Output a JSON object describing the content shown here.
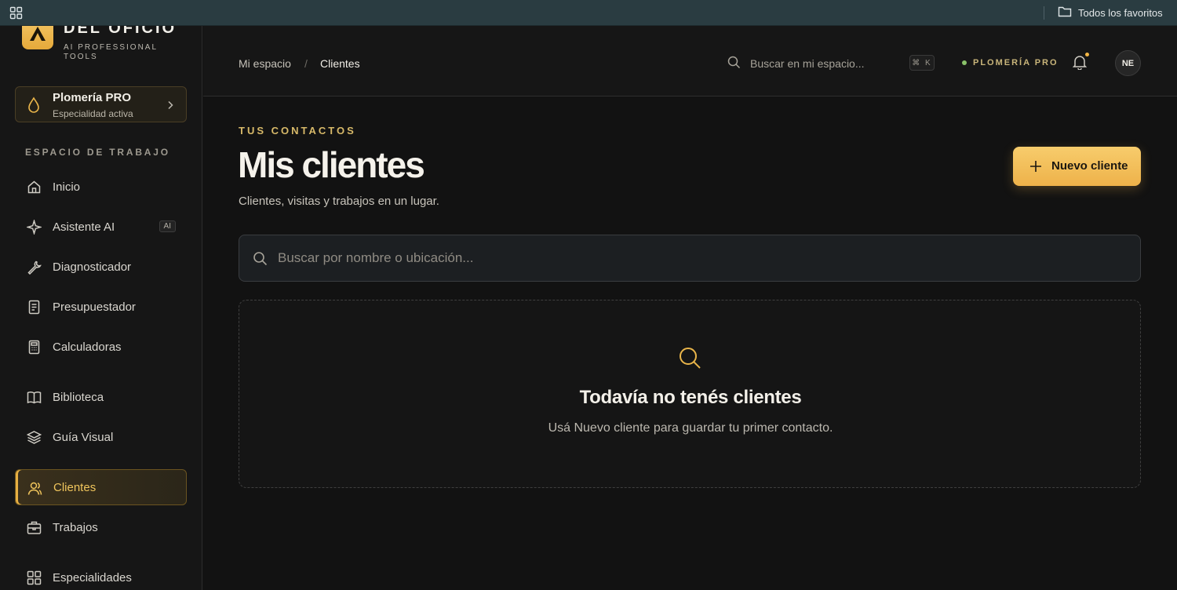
{
  "browser": {
    "favorites_label": "Todos los favoritos"
  },
  "brand": {
    "title": "DEL OFICIO",
    "subtitle": "AI PROFESSIONAL TOOLS",
    "accent": "#eeb24a"
  },
  "specialty": {
    "name": "Plomería PRO",
    "status": "Especialidad activa"
  },
  "sidebar": {
    "section_label": "ESPACIO DE TRABAJO",
    "items": [
      {
        "label": "Inicio",
        "icon": "home-icon"
      },
      {
        "label": "Asistente AI",
        "icon": "sparkle-icon",
        "badge": "AI"
      },
      {
        "label": "Diagnosticador",
        "icon": "wrench-icon"
      },
      {
        "label": "Presupuestador",
        "icon": "document-icon"
      },
      {
        "label": "Calculadoras",
        "icon": "calculator-icon"
      },
      {
        "label": "Biblioteca",
        "icon": "book-icon"
      },
      {
        "label": "Guía Visual",
        "icon": "layers-icon"
      },
      {
        "label": "Clientes",
        "icon": "users-icon",
        "active": true
      },
      {
        "label": "Trabajos",
        "icon": "briefcase-icon"
      },
      {
        "label": "Especialidades",
        "icon": "grid-icon"
      }
    ]
  },
  "header": {
    "breadcrumb": [
      "Mi espacio",
      "Clientes"
    ],
    "breadcrumb_separator": "/",
    "search_placeholder": "Buscar en mi espacio...",
    "shortcut": "⌘ K",
    "plan_label": "PLOMERÍA PRO",
    "avatar_initials": "NE"
  },
  "main": {
    "eyebrow": "TUS CONTACTOS",
    "title": "Mis clientes",
    "subtitle": "Clientes, visitas y trabajos en un lugar.",
    "new_button": "Nuevo cliente",
    "search_placeholder": "Buscar por nombre o ubicación...",
    "empty_title": "Todavía no tenés clientes",
    "empty_desc": "Usá Nuevo cliente para guardar tu primer contacto."
  }
}
